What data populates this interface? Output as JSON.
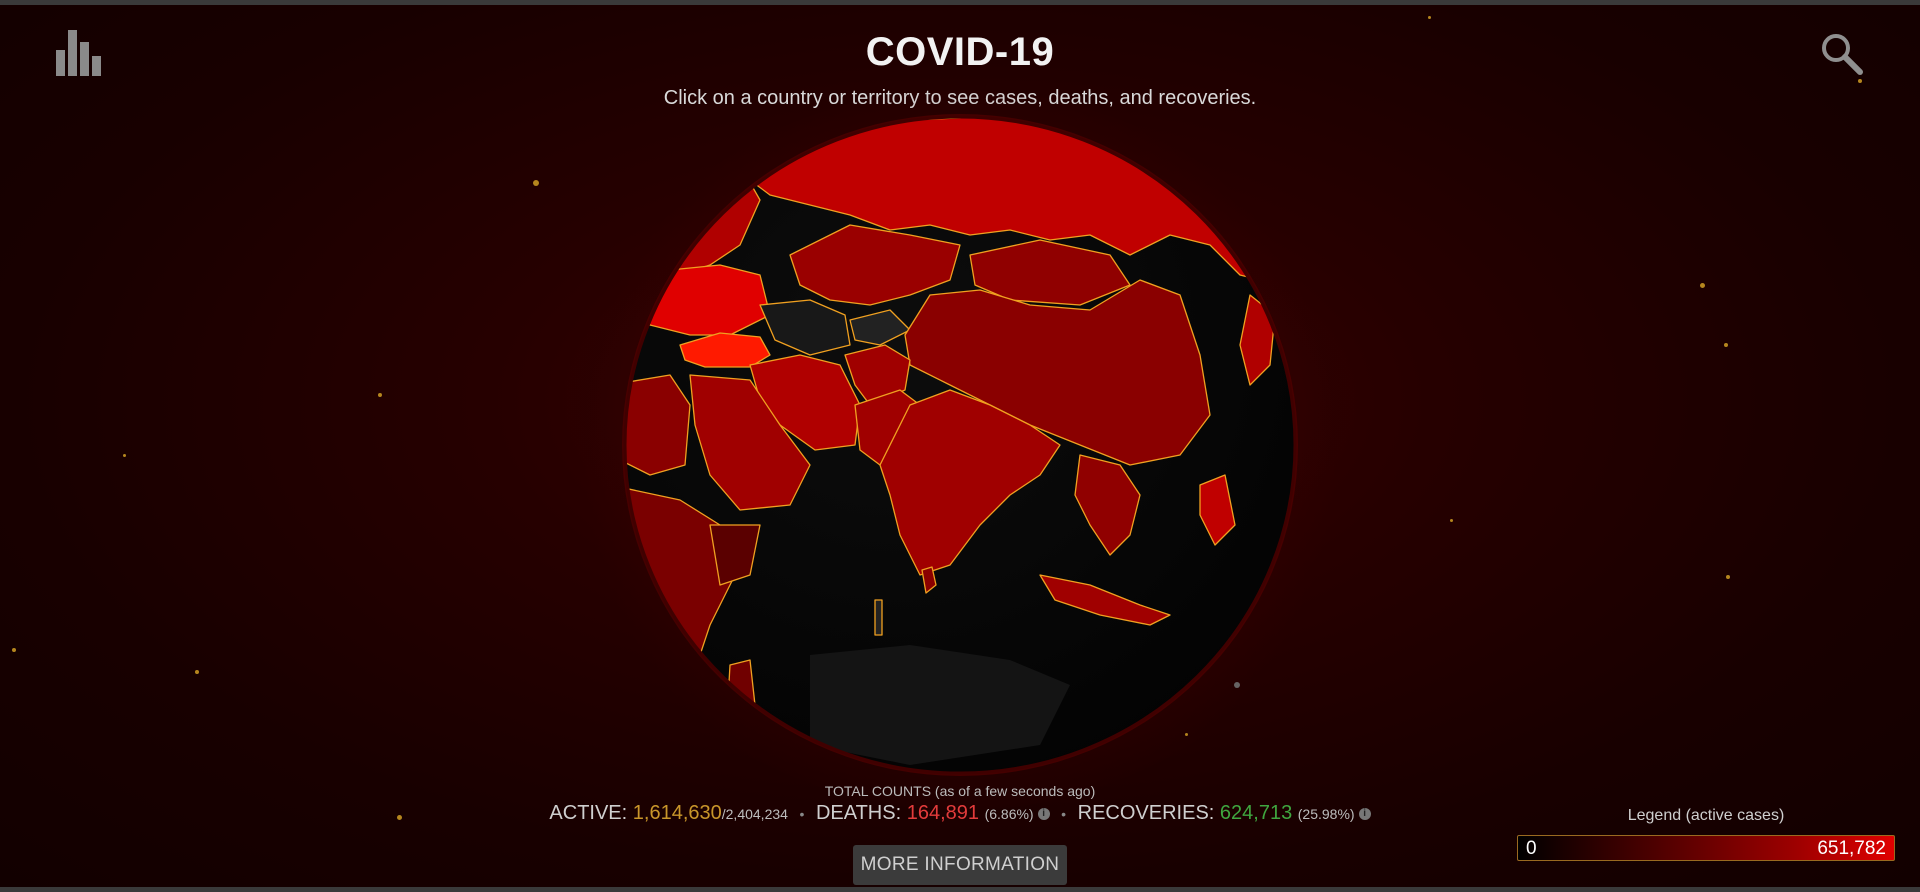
{
  "header": {
    "title": "COVID-19",
    "subtitle": "Click on a country or territory to see cases, deaths, and recoveries."
  },
  "icons": {
    "stats": "bar-chart-icon",
    "search": "search-icon"
  },
  "totals": {
    "caption": "TOTAL COUNTS (as of a few seconds ago)",
    "active_label": "ACTIVE:",
    "active_value": "1,614,630",
    "active_total": "/2,404,234",
    "deaths_label": "DEATHS:",
    "deaths_value": "164,891",
    "deaths_pct": "(6.86%)",
    "recoveries_label": "RECOVERIES:",
    "recoveries_value": "624,713",
    "recoveries_pct": "(25.98%)",
    "separator": "•"
  },
  "more_button": "MORE INFORMATION",
  "legend": {
    "title": "Legend (active cases)",
    "min": "0",
    "max": "651,782"
  },
  "colors": {
    "background": "#1c0000",
    "active": "#c9962a",
    "deaths": "#e23b3b",
    "recoveries": "#3fa63f",
    "country_border": "#f0a020",
    "country_fill_high": "#d10000"
  }
}
